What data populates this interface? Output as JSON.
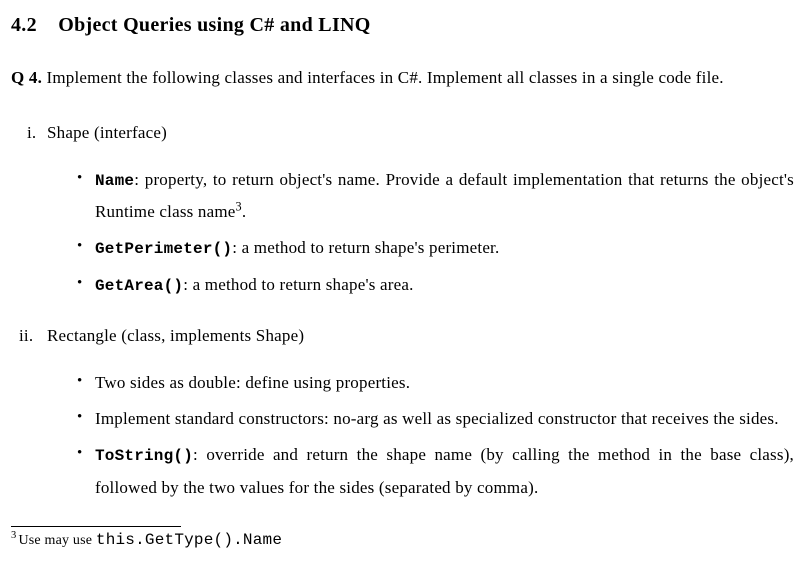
{
  "section": {
    "number": "4.2",
    "title": "Object Queries using C# and LINQ"
  },
  "question": {
    "label": "Q 4.",
    "text": "Implement the following classes and interfaces in C#. Implement all classes in a single code file."
  },
  "items": [
    {
      "marker": "i.",
      "heading": "Shape (interface)",
      "bullets": [
        {
          "code": "Name",
          "after_code": ": property, to return object's name. Provide a default implementation that returns the object's Runtime class name",
          "sup": "3",
          "tail": "."
        },
        {
          "code": "GetPerimeter()",
          "after_code": ": a method to return shape's perimeter."
        },
        {
          "code": "GetArea()",
          "after_code": ": a method to return shape's area."
        }
      ]
    },
    {
      "marker": "ii.",
      "heading": "Rectangle (class, implements Shape)",
      "bullets": [
        {
          "plain": "Two sides as double: define using properties."
        },
        {
          "plain": "Implement standard constructors: no-arg as well as specialized constructor that receives the sides."
        },
        {
          "code": "ToString()",
          "after_code": ": override and return the shape name (by calling the method in the base class), followed by the two values for the sides (separated by comma)."
        }
      ]
    }
  ],
  "footnote": {
    "marker": "3",
    "pre": "Use may use ",
    "code": "this.GetType().Name"
  }
}
